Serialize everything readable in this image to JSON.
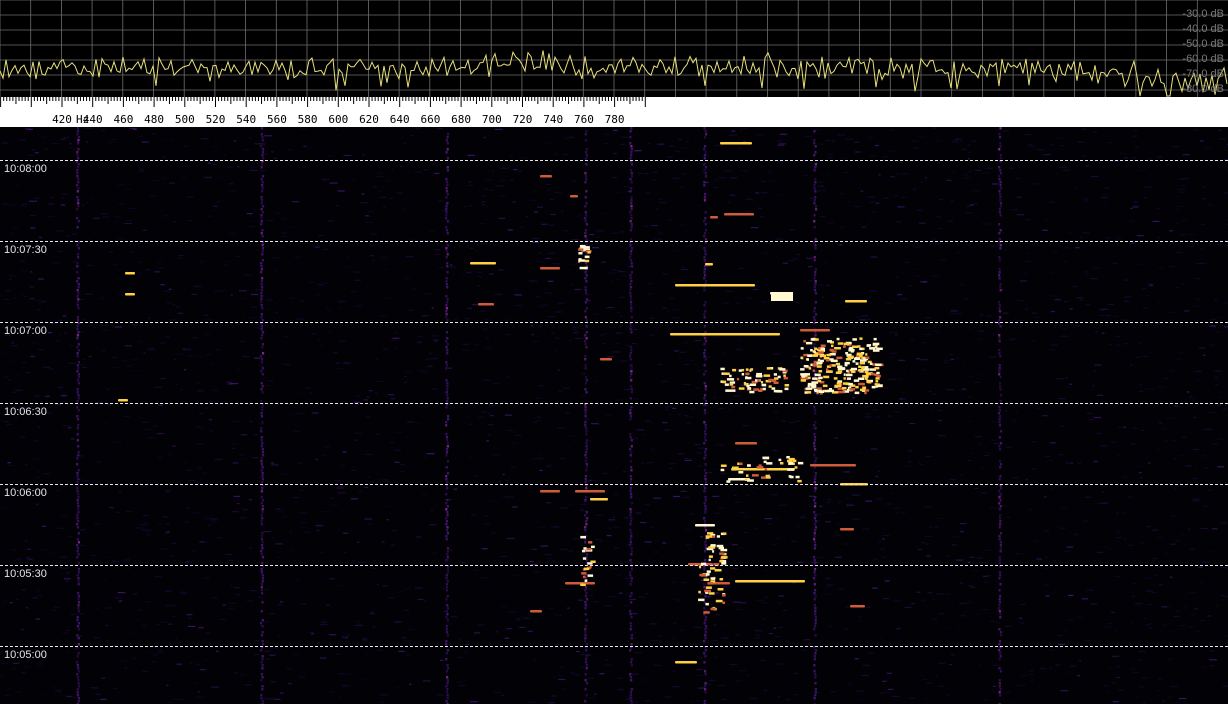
{
  "spectrum": {
    "db_labels": [
      "-30.0 dB",
      "-40.0 dB",
      "-50.0 dB",
      "-60.0 dB",
      "-70.0 dB",
      "-80.0 dB"
    ],
    "trace_color": "#e8e07a",
    "grid_color": "#6e6e6e"
  },
  "scale": {
    "unit_label": "Hz",
    "first_label": "420",
    "labels": [
      "440",
      "460",
      "480",
      "500",
      "520",
      "540",
      "560",
      "580",
      "600",
      "620",
      "640",
      "660",
      "680",
      "700",
      "720",
      "740",
      "760",
      "780"
    ],
    "marker_color": "#55dd22"
  },
  "waterfall": {
    "time_labels": [
      "10:08:00",
      "10:07:30",
      "10:07:00",
      "10:06:30",
      "10:06:00",
      "10:05:30",
      "10:05:00"
    ],
    "palette": [
      "#1a0a3a",
      "#4a1880",
      "#8a2a9a",
      "#d05a3a",
      "#ffd040",
      "#fff8d0"
    ]
  }
}
